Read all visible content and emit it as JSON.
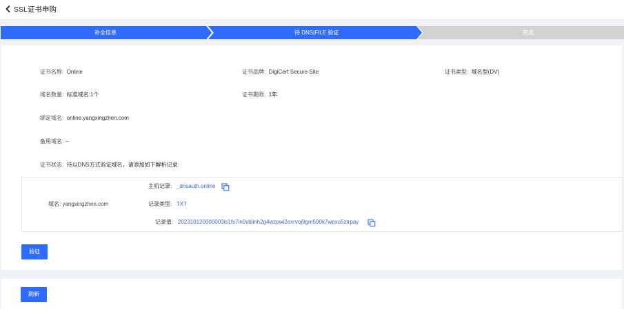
{
  "header": {
    "title": "SSL证书申购",
    "back_icon": "chevron-left-icon"
  },
  "steps": [
    {
      "label": "补全信息",
      "state": "done"
    },
    {
      "label": "待 DNS|FILE 验证",
      "state": "active"
    },
    {
      "label": "完成",
      "state": "pending"
    }
  ],
  "colors": {
    "primary": "#2f6bff",
    "step_pending": "#d2d2d2",
    "link": "#3b63d6"
  },
  "cert": {
    "name_label": "证书名称:",
    "name": "Online",
    "brand_label": "证书品牌:",
    "brand": "DigiCert Secure Site",
    "type_label": "证书类型:",
    "type": "域名型(DV)",
    "domain_count_label": "域名数量:",
    "domain_count": "标准域名:1个",
    "period_label": "证书期限:",
    "period": "1年",
    "bound_domain_label": "绑定域名:",
    "bound_domain": "online.yangxingzhen.com",
    "backup_domain_label": "备用域名:",
    "backup_domain": "--",
    "status_label": "证书状态:",
    "status": "待以DNS方式验证域名，请添加如下解析记录:"
  },
  "record": {
    "domain_label": "域名:",
    "domain": "yangxingzhen.com",
    "host_label": "主机记录:",
    "host": "_dnsauth.online",
    "type_label": "记录类型:",
    "type": "TXT",
    "value_label": "记录值:",
    "value": "202310120000003is1fs7in0vblinh2g4wzpwi2exrvoj9gm590k7wpxu5ztrpay",
    "copy_icon": "copy-icon"
  },
  "buttons": {
    "verify": "验证",
    "refresh": "刷新"
  }
}
